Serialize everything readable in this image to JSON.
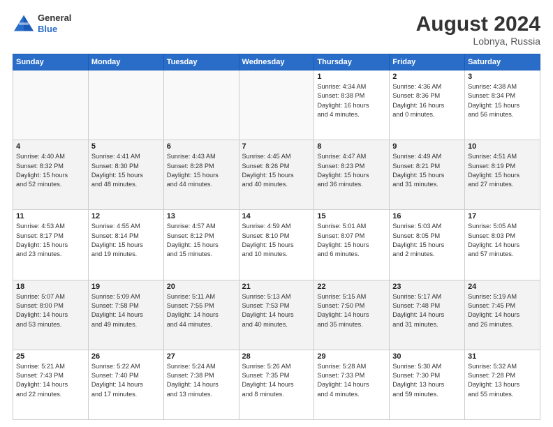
{
  "header": {
    "logo": {
      "general": "General",
      "blue": "Blue"
    },
    "title": "August 2024",
    "location": "Lobnya, Russia"
  },
  "days_of_week": [
    "Sunday",
    "Monday",
    "Tuesday",
    "Wednesday",
    "Thursday",
    "Friday",
    "Saturday"
  ],
  "weeks": [
    [
      {
        "day": "",
        "content": "",
        "empty": true
      },
      {
        "day": "",
        "content": "",
        "empty": true
      },
      {
        "day": "",
        "content": "",
        "empty": true
      },
      {
        "day": "",
        "content": "",
        "empty": true
      },
      {
        "day": "1",
        "content": "Sunrise: 4:34 AM\nSunset: 8:38 PM\nDaylight: 16 hours\nand 4 minutes.",
        "empty": false
      },
      {
        "day": "2",
        "content": "Sunrise: 4:36 AM\nSunset: 8:36 PM\nDaylight: 16 hours\nand 0 minutes.",
        "empty": false
      },
      {
        "day": "3",
        "content": "Sunrise: 4:38 AM\nSunset: 8:34 PM\nDaylight: 15 hours\nand 56 minutes.",
        "empty": false
      }
    ],
    [
      {
        "day": "4",
        "content": "Sunrise: 4:40 AM\nSunset: 8:32 PM\nDaylight: 15 hours\nand 52 minutes.",
        "empty": false
      },
      {
        "day": "5",
        "content": "Sunrise: 4:41 AM\nSunset: 8:30 PM\nDaylight: 15 hours\nand 48 minutes.",
        "empty": false
      },
      {
        "day": "6",
        "content": "Sunrise: 4:43 AM\nSunset: 8:28 PM\nDaylight: 15 hours\nand 44 minutes.",
        "empty": false
      },
      {
        "day": "7",
        "content": "Sunrise: 4:45 AM\nSunset: 8:26 PM\nDaylight: 15 hours\nand 40 minutes.",
        "empty": false
      },
      {
        "day": "8",
        "content": "Sunrise: 4:47 AM\nSunset: 8:23 PM\nDaylight: 15 hours\nand 36 minutes.",
        "empty": false
      },
      {
        "day": "9",
        "content": "Sunrise: 4:49 AM\nSunset: 8:21 PM\nDaylight: 15 hours\nand 31 minutes.",
        "empty": false
      },
      {
        "day": "10",
        "content": "Sunrise: 4:51 AM\nSunset: 8:19 PM\nDaylight: 15 hours\nand 27 minutes.",
        "empty": false
      }
    ],
    [
      {
        "day": "11",
        "content": "Sunrise: 4:53 AM\nSunset: 8:17 PM\nDaylight: 15 hours\nand 23 minutes.",
        "empty": false
      },
      {
        "day": "12",
        "content": "Sunrise: 4:55 AM\nSunset: 8:14 PM\nDaylight: 15 hours\nand 19 minutes.",
        "empty": false
      },
      {
        "day": "13",
        "content": "Sunrise: 4:57 AM\nSunset: 8:12 PM\nDaylight: 15 hours\nand 15 minutes.",
        "empty": false
      },
      {
        "day": "14",
        "content": "Sunrise: 4:59 AM\nSunset: 8:10 PM\nDaylight: 15 hours\nand 10 minutes.",
        "empty": false
      },
      {
        "day": "15",
        "content": "Sunrise: 5:01 AM\nSunset: 8:07 PM\nDaylight: 15 hours\nand 6 minutes.",
        "empty": false
      },
      {
        "day": "16",
        "content": "Sunrise: 5:03 AM\nSunset: 8:05 PM\nDaylight: 15 hours\nand 2 minutes.",
        "empty": false
      },
      {
        "day": "17",
        "content": "Sunrise: 5:05 AM\nSunset: 8:03 PM\nDaylight: 14 hours\nand 57 minutes.",
        "empty": false
      }
    ],
    [
      {
        "day": "18",
        "content": "Sunrise: 5:07 AM\nSunset: 8:00 PM\nDaylight: 14 hours\nand 53 minutes.",
        "empty": false
      },
      {
        "day": "19",
        "content": "Sunrise: 5:09 AM\nSunset: 7:58 PM\nDaylight: 14 hours\nand 49 minutes.",
        "empty": false
      },
      {
        "day": "20",
        "content": "Sunrise: 5:11 AM\nSunset: 7:55 PM\nDaylight: 14 hours\nand 44 minutes.",
        "empty": false
      },
      {
        "day": "21",
        "content": "Sunrise: 5:13 AM\nSunset: 7:53 PM\nDaylight: 14 hours\nand 40 minutes.",
        "empty": false
      },
      {
        "day": "22",
        "content": "Sunrise: 5:15 AM\nSunset: 7:50 PM\nDaylight: 14 hours\nand 35 minutes.",
        "empty": false
      },
      {
        "day": "23",
        "content": "Sunrise: 5:17 AM\nSunset: 7:48 PM\nDaylight: 14 hours\nand 31 minutes.",
        "empty": false
      },
      {
        "day": "24",
        "content": "Sunrise: 5:19 AM\nSunset: 7:45 PM\nDaylight: 14 hours\nand 26 minutes.",
        "empty": false
      }
    ],
    [
      {
        "day": "25",
        "content": "Sunrise: 5:21 AM\nSunset: 7:43 PM\nDaylight: 14 hours\nand 22 minutes.",
        "empty": false
      },
      {
        "day": "26",
        "content": "Sunrise: 5:22 AM\nSunset: 7:40 PM\nDaylight: 14 hours\nand 17 minutes.",
        "empty": false
      },
      {
        "day": "27",
        "content": "Sunrise: 5:24 AM\nSunset: 7:38 PM\nDaylight: 14 hours\nand 13 minutes.",
        "empty": false
      },
      {
        "day": "28",
        "content": "Sunrise: 5:26 AM\nSunset: 7:35 PM\nDaylight: 14 hours\nand 8 minutes.",
        "empty": false
      },
      {
        "day": "29",
        "content": "Sunrise: 5:28 AM\nSunset: 7:33 PM\nDaylight: 14 hours\nand 4 minutes.",
        "empty": false
      },
      {
        "day": "30",
        "content": "Sunrise: 5:30 AM\nSunset: 7:30 PM\nDaylight: 13 hours\nand 59 minutes.",
        "empty": false
      },
      {
        "day": "31",
        "content": "Sunrise: 5:32 AM\nSunset: 7:28 PM\nDaylight: 13 hours\nand 55 minutes.",
        "empty": false
      }
    ]
  ]
}
